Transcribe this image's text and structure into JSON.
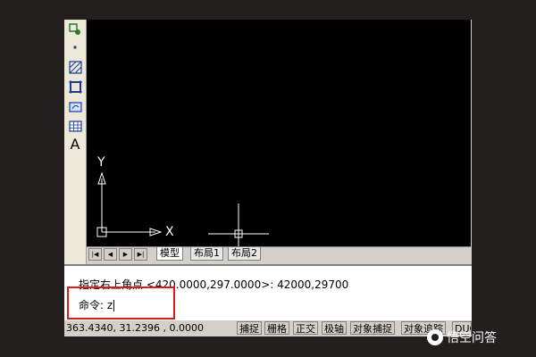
{
  "toolbar": {
    "icons": [
      "insert-block-icon",
      "point-icon",
      "hatch-icon",
      "region-icon",
      "wipeout-icon",
      "table-icon",
      "text-icon"
    ],
    "text_label": "A"
  },
  "canvas": {
    "ucs_y_label": "Y",
    "ucs_x_label": "X"
  },
  "tabs": {
    "items": [
      "模型",
      "布局1",
      "布局2"
    ],
    "active": "模型"
  },
  "command": {
    "history_line": "指定右上角点 <420.0000,297.0000>: 42000,29700",
    "prompt": "命令: z"
  },
  "status": {
    "coordinates": "363.4340,  31.2396  , 0.0000",
    "buttons": [
      "捕捉",
      "栅格",
      "正交",
      "极轴",
      "对象捕捉",
      "对象追踪",
      "DUCS"
    ]
  },
  "watermark": "悟空问答",
  "colors": {
    "canvas_bg": "#000000",
    "highlight_box": "#d81c1c"
  }
}
